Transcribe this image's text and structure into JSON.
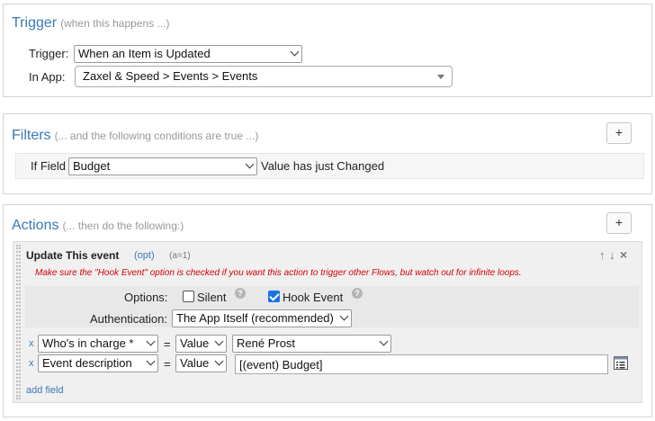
{
  "trigger": {
    "title": "Trigger",
    "hint": "(when this happens ...)",
    "trigger_label": "Trigger:",
    "trigger_value": "When an Item is Updated",
    "app_label": "In App:",
    "app_value": "Zaxel & Speed > Events > Events"
  },
  "filters": {
    "title": "Filters",
    "hint": "(... and the following conditions are true ...)",
    "add_label": "+",
    "if_field_label": "If Field",
    "field_value": "Budget",
    "condition_text": "Value has just Changed"
  },
  "actions": {
    "title": "Actions",
    "hint": "(... then do the following:)",
    "add_label": "+",
    "action_title": "Update This event",
    "opt_label": "(opt)",
    "id_label": "(a=1)",
    "warning": "Make sure the \"Hook Event\" option is checked if you want this action to trigger other Flows, but watch out for infinite loops.",
    "options_label": "Options:",
    "silent_label": "Silent",
    "silent_checked": false,
    "hook_event_label": "Hook Event",
    "hook_event_checked": true,
    "auth_label": "Authentication:",
    "auth_value": "The App Itself (recommended)",
    "rows": [
      {
        "remove": "x",
        "field": "Who's in charge *",
        "eq": "=",
        "mode": "Value",
        "value": "René Prost"
      },
      {
        "remove": "x",
        "field": "Event description",
        "eq": "=",
        "mode": "Value",
        "value": "[(event) Budget]"
      }
    ],
    "add_field_label": "add field"
  }
}
